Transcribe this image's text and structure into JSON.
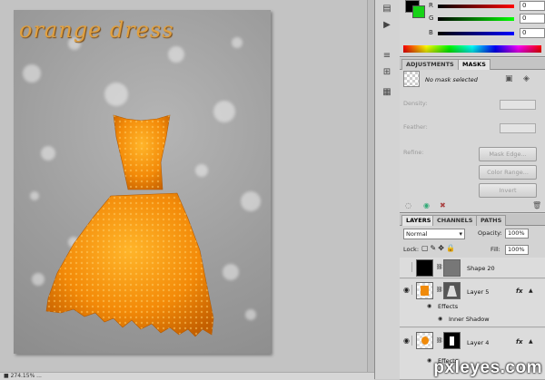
{
  "canvas": {
    "document_title": "orange dress",
    "status_text": "■ 274.15% ...",
    "watermark": "pxleyes.com"
  },
  "color_panel": {
    "sliders": [
      {
        "label": "R",
        "value": "0"
      },
      {
        "label": "G",
        "value": "0"
      },
      {
        "label": "B",
        "value": "0"
      }
    ],
    "foreground_color": "#000000",
    "background_color": "#16d316"
  },
  "masks_panel": {
    "tabs": [
      "ADJUSTMENTS",
      "MASKS"
    ],
    "active_tab": "MASKS",
    "no_mask_text": "No mask selected",
    "density_label": "Density:",
    "feather_label": "Feather:",
    "refine_label": "Refine:",
    "buttons": [
      "Mask Edge...",
      "Color Range...",
      "Invert"
    ]
  },
  "layers_panel": {
    "tabs": [
      "LAYERS",
      "CHANNELS",
      "PATHS"
    ],
    "active_tab": "LAYERS",
    "blend_mode": "Normal",
    "opacity_label": "Opacity:",
    "opacity_value": "100%",
    "lock_label": "Lock:",
    "fill_label": "Fill:",
    "fill_value": "100%",
    "layers": [
      {
        "name": "Shape 20"
      },
      {
        "name": "Layer 5",
        "effects_label": "Effects",
        "effect": "Inner Shadow"
      },
      {
        "name": "Layer 4",
        "effects_label": "Effects"
      }
    ]
  }
}
